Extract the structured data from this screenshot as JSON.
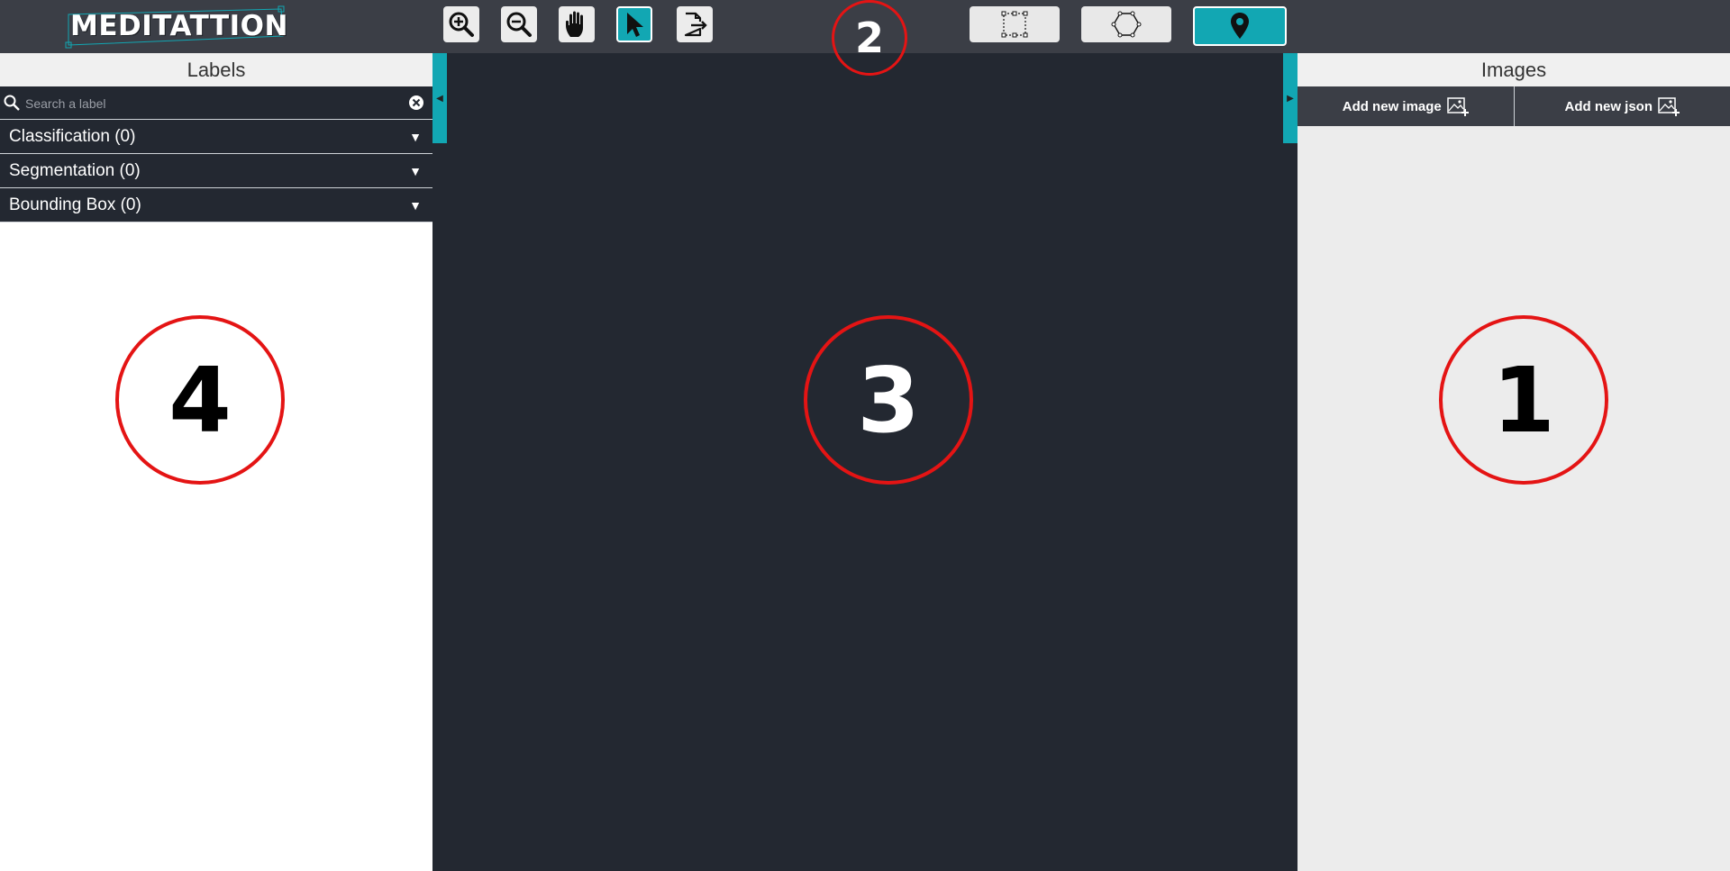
{
  "app": {
    "logo_text": "MEDITATTION"
  },
  "toolbar": {
    "tools": [
      {
        "icon": "zoom-in-icon"
      },
      {
        "icon": "zoom-out-icon"
      },
      {
        "icon": "hand-pan-icon"
      },
      {
        "icon": "cursor-select-icon",
        "active": true
      },
      {
        "icon": "export-icon"
      }
    ],
    "shapes": [
      {
        "icon": "rectangle-shape-icon"
      },
      {
        "icon": "polygon-shape-icon"
      },
      {
        "icon": "point-pin-icon",
        "active": true
      }
    ]
  },
  "left_panel": {
    "title": "Labels",
    "search_placeholder": "Search a label",
    "categories": [
      {
        "label": "Classification (0)"
      },
      {
        "label": "Segmentation (0)"
      },
      {
        "label": "Bounding Box (0)"
      }
    ]
  },
  "right_panel": {
    "title": "Images",
    "add_image_label": "Add new image",
    "add_json_label": "Add new json"
  },
  "markers": {
    "m1": "1",
    "m2": "2",
    "m3": "3",
    "m4": "4"
  },
  "colors": {
    "accent": "#12a7b3",
    "topbar": "#3b3e46",
    "canvas": "#232831",
    "marker": "#e41414"
  }
}
